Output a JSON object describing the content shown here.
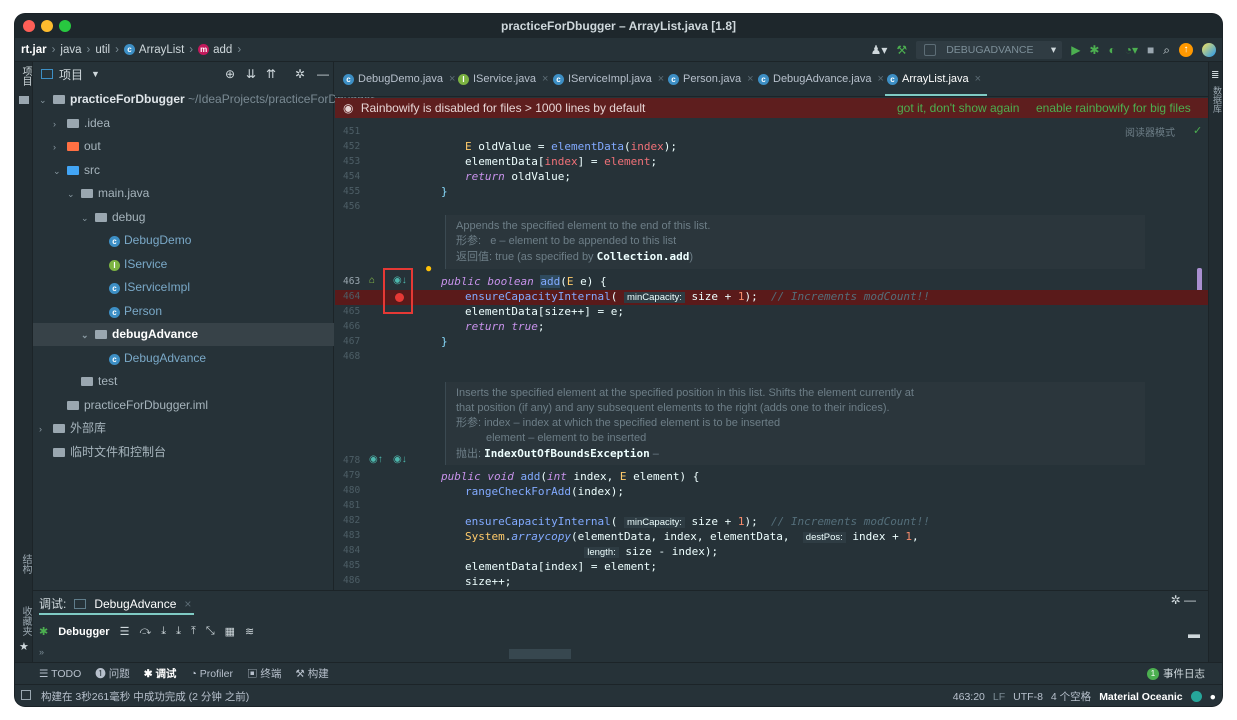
{
  "window": {
    "title": "practiceForDbugger – ArrayList.java [1.8]",
    "colors": {
      "close": "#ff5f57",
      "minimize": "#febc2e",
      "maximize": "#28c840"
    }
  },
  "breadcrumb": [
    "rt.jar",
    "java",
    "util",
    "ArrayList",
    "add"
  ],
  "run_config": {
    "name": "DEBUGADVANCE"
  },
  "left_strip": {
    "project": "项目",
    "structure": "结构",
    "favorites": "收藏夹"
  },
  "right_strip": {
    "database": "数据库"
  },
  "project_panel": {
    "title": "项目",
    "tree": [
      {
        "label": "practiceForDbugger",
        "suffix": "~/IdeaProjects/practiceForDbugger",
        "indent": 0,
        "kind": "module",
        "expanded": true
      },
      {
        "label": ".idea",
        "indent": 1,
        "kind": "folder",
        "expanded": false
      },
      {
        "label": "out",
        "indent": 1,
        "kind": "folder-orange",
        "expanded": false
      },
      {
        "label": "src",
        "indent": 1,
        "kind": "folder-blue",
        "expanded": true
      },
      {
        "label": "main.java",
        "indent": 2,
        "kind": "package",
        "expanded": true
      },
      {
        "label": "debug",
        "indent": 3,
        "kind": "package",
        "expanded": true
      },
      {
        "label": "DebugDemo",
        "indent": 4,
        "kind": "class-run"
      },
      {
        "label": "IService",
        "indent": 4,
        "kind": "interface"
      },
      {
        "label": "IServiceImpl",
        "indent": 4,
        "kind": "class"
      },
      {
        "label": "Person",
        "indent": 4,
        "kind": "class"
      },
      {
        "label": "debugAdvance",
        "indent": 3,
        "kind": "package",
        "expanded": true,
        "selected": true
      },
      {
        "label": "DebugAdvance",
        "indent": 4,
        "kind": "class-run"
      },
      {
        "label": "test",
        "indent": 2,
        "kind": "package"
      },
      {
        "label": "practiceForDbugger.iml",
        "indent": 1,
        "kind": "file"
      },
      {
        "label": "外部库",
        "indent": 0,
        "kind": "library",
        "expanded": false
      },
      {
        "label": "临时文件和控制台",
        "indent": 0,
        "kind": "scratch"
      }
    ]
  },
  "tabs": [
    {
      "label": "DebugDemo.java",
      "icon": "class-run-icon",
      "active": false
    },
    {
      "label": "IService.java",
      "icon": "interface-icon",
      "active": false
    },
    {
      "label": "IServiceImpl.java",
      "icon": "class-icon",
      "active": false
    },
    {
      "label": "Person.java",
      "icon": "class-icon",
      "active": false
    },
    {
      "label": "DebugAdvance.java",
      "icon": "class-run-icon",
      "active": false
    },
    {
      "label": "ArrayList.java",
      "icon": "class-lib-icon",
      "active": true
    }
  ],
  "banner": {
    "text": "Rainbowify is disabled for files > 1000 lines by default",
    "action1": "got it, don't show again",
    "action2": "enable rainbowify for big files"
  },
  "editor": {
    "reader_mode": "阅读器模式",
    "line_numbers": [
      "451",
      "452",
      "453",
      "454",
      "455",
      "456",
      "463",
      "464",
      "465",
      "466",
      "467",
      "468",
      "478",
      "479",
      "480",
      "481",
      "482",
      "483",
      "484",
      "485",
      "486"
    ],
    "code": {
      "l452": "E oldValue = elementData(index);",
      "l453": "elementData[index] = element;",
      "l454": "return oldValue;",
      "l455": "}",
      "l463": "public boolean add(E e) {",
      "l464": "ensureCapacityInternal(minCapacity: size + 1);  // Increments modCount!!",
      "l465": "elementData[size++] = e;",
      "l466": "return true;",
      "l467": "}",
      "l478": "public void add(int index, E element) {",
      "l479": "rangeCheckForAdd(index);",
      "l481": "ensureCapacityInternal(minCapacity: size + 1);  // Increments modCount!!",
      "l482": "System.arraycopy(elementData, index, elementData,  destPos: index + 1,",
      "l483": "length: size - index);",
      "l484": "elementData[index] = element;",
      "l485": "size++;",
      "l486": "}"
    },
    "doc1": {
      "summary": "Appends the specified element to the end of this list.",
      "param_label": "形参:",
      "param": "e – element to be appended to this list",
      "return_label": "返回值:",
      "return_text": "true (as specified by",
      "return_link": "Collection.add",
      "return_tail": ")"
    },
    "doc2": {
      "summary1": "Inserts the specified element at the specified position in this list. Shifts the element currently at",
      "summary2": "that position (if any) and any subsequent elements to the right (adds one to their indices).",
      "param_label": "形参:",
      "param1": "index – index at which the specified element is to be inserted",
      "param2": "element – element to be inserted",
      "throws_label": "抛出:",
      "throws": "IndexOutOfBoundsException",
      "throws_tail": "–"
    }
  },
  "debug_panel": {
    "label": "调试:",
    "session_tab": "DebugAdvance",
    "debugger_tab": "Debugger"
  },
  "tool_windows": [
    {
      "label": "TODO",
      "icon": "list-icon"
    },
    {
      "label": "问题",
      "icon": "problems-icon"
    },
    {
      "label": "调试",
      "icon": "bug-icon",
      "active": true
    },
    {
      "label": "Profiler",
      "icon": "profiler-icon"
    },
    {
      "label": "终端",
      "icon": "terminal-icon"
    },
    {
      "label": "构建",
      "icon": "hammer-icon"
    }
  ],
  "event_log": {
    "count": "1",
    "label": "事件日志"
  },
  "status": {
    "message": "构建在 3秒261毫秒 中成功完成 (2 分钟 之前)",
    "position": "463:20",
    "line_sep": "LF",
    "encoding": "UTF-8",
    "indent": "4 个空格",
    "theme": "Material Oceanic"
  }
}
